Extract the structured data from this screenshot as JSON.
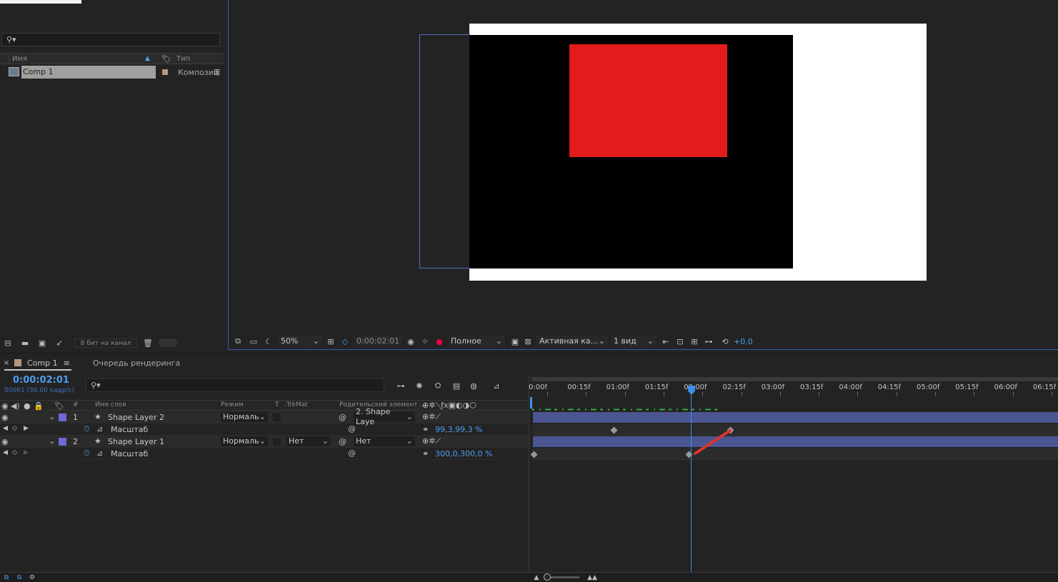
{
  "project": {
    "search_placeholder": "",
    "columns": {
      "name": "Имя",
      "type": "Тип"
    },
    "items": [
      {
        "name": "Comp 1",
        "type": "Композиц",
        "label_color": "#b49a7c"
      }
    ],
    "bit_depth": "8 бит на канал"
  },
  "viewer": {
    "zoom": "50%",
    "timecode": "0:00:02:01",
    "resolution": "Полное",
    "camera": "Активная ка...",
    "views": "1 вид",
    "exposure": "+0,0",
    "colors": {
      "canvas": "#ffffff",
      "comp_bg": "#000000",
      "shape": "#e31b1b",
      "outline": "#4e6fb3"
    }
  },
  "timeline": {
    "tabs": [
      {
        "label": "Comp 1"
      },
      {
        "label": "Очередь рендеринга"
      }
    ],
    "current_time": "0:00:02:01",
    "frames": "00061 (30.00 кадр/с)",
    "columns": {
      "num": "#",
      "layer_name": "Имя слоя",
      "mode": "Режим",
      "t": "T",
      "trkmat": ".TrkMat",
      "parent": "Родительский элемент ..."
    },
    "layers": [
      {
        "num": "1",
        "name": "Shape Layer 2",
        "mode": "Нормаль",
        "trkmat": "",
        "parent": "2. Shape Laye",
        "prop_name": "Масштаб",
        "prop_value": "99,3,99,3 %"
      },
      {
        "num": "2",
        "name": "Shape Layer 1",
        "mode": "Нормаль",
        "trkmat": "Нет",
        "parent": "Нет",
        "prop_name": "Масштаб",
        "prop_value": "300,0,300,0 %"
      }
    ],
    "ruler": [
      "0:00f",
      "00:15f",
      "01:00f",
      "01:15f",
      "02:00f",
      "02:15f",
      "03:00f",
      "03:15f",
      "04:00f",
      "04:15f",
      "05:00f",
      "05:15f",
      "06:00f",
      "06:15f"
    ],
    "track_color": "#4b5590",
    "playhead_color": "#3d8fe8"
  }
}
